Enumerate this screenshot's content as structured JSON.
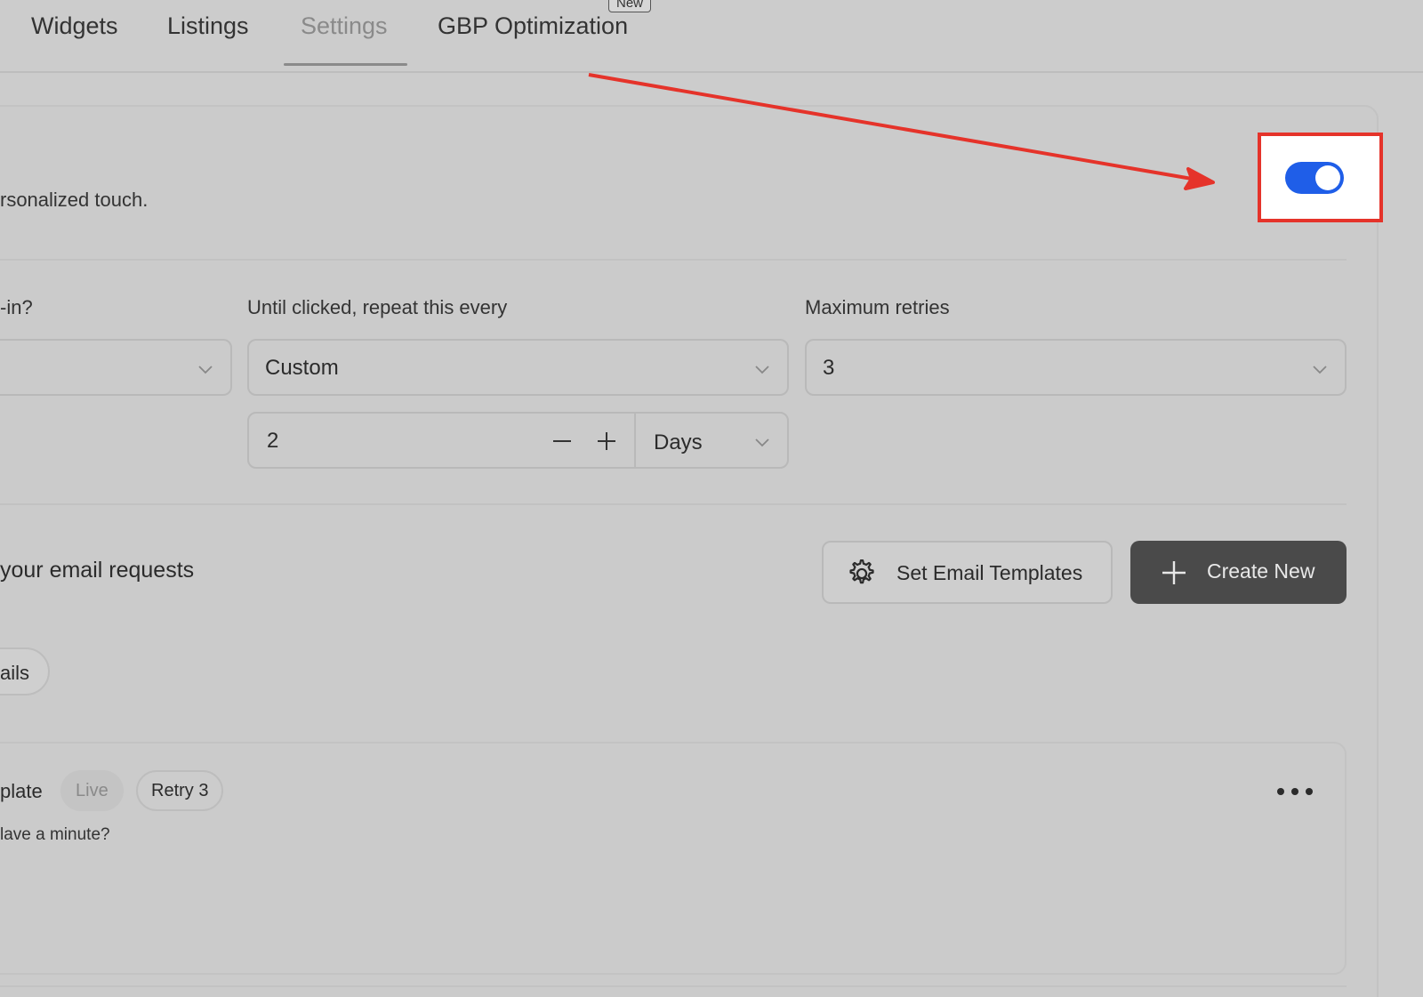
{
  "nav": {
    "tabs": [
      {
        "label": "Widgets"
      },
      {
        "label": "Listings"
      },
      {
        "label": "Settings"
      },
      {
        "label": "GBP Optimization"
      }
    ],
    "new_badge": "New"
  },
  "header": {
    "subtitle": "rsonalized touch."
  },
  "toggle": {
    "enabled": true,
    "accent": "#1f5ee8",
    "highlight_color": "#e5332a"
  },
  "form": {
    "label_first": "-in?",
    "label_repeat": "Until clicked, repeat this every",
    "label_retries": "Maximum retries",
    "repeat_value": "Custom",
    "retries_value": "3",
    "interval_value": "2",
    "interval_unit": "Days"
  },
  "email": {
    "section_title": "your email requests",
    "set_templates_label": "Set Email Templates",
    "create_new_label": "Create New",
    "chip_label": "ails"
  },
  "template": {
    "name": "plate",
    "status_badge": "Live",
    "retry_badge": "Retry 3",
    "description": "lave a minute?"
  },
  "icons": {
    "dropdown": "chevron-down-icon",
    "minus": "minus-icon",
    "plus": "plus-icon",
    "settings": "gear-icon",
    "create": "plus-icon",
    "more": "more-horizontal-icon"
  }
}
